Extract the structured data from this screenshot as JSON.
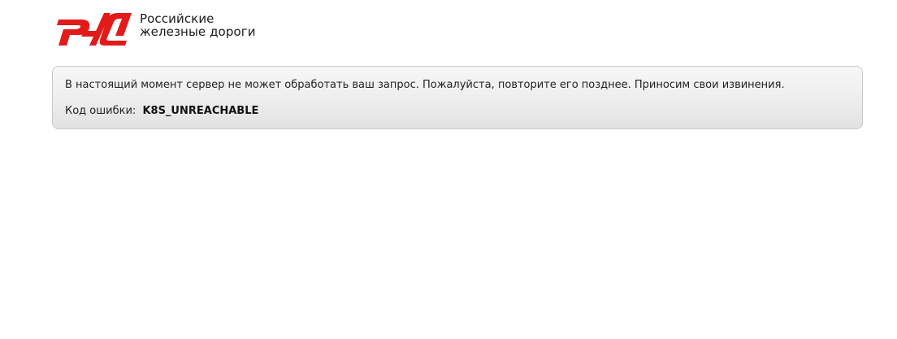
{
  "brand": {
    "logo_icon": "rzd-logo-icon",
    "accent_color": "#e21a1a",
    "line1": "Российские",
    "line2": "железные дороги"
  },
  "error": {
    "message": "В настоящий момент сервер не может обработать ваш запрос. Пожалуйста, повторите его позднее. Приносим свои извинения.",
    "code_label": "Код ошибки:",
    "code_value": "K8S_UNREACHABLE"
  }
}
